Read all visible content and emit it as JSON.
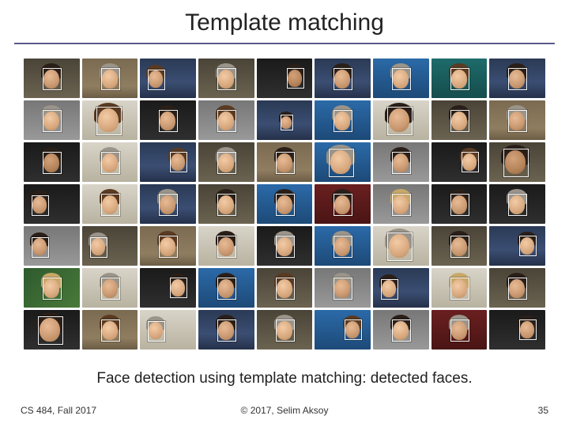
{
  "title": "Template matching",
  "caption": "Face detection using template matching: detected faces.",
  "footer": {
    "left": "CS 484, Fall 2017",
    "center": "© 2017, Selim Aksoy",
    "right": "35"
  },
  "grid": {
    "rows": 7,
    "cols": 9,
    "thumbs": [
      {
        "bg": "bg-room",
        "box": "box-c",
        "pos": "p-c",
        "skin": "skin-2",
        "hair": "hair-dark"
      },
      {
        "bg": "bg-wall",
        "box": "box-c",
        "pos": "p-c",
        "skin": "skin-1",
        "hair": "hair-gray"
      },
      {
        "bg": "bg-studio",
        "box": "box-l",
        "pos": "p-l",
        "skin": "skin-2",
        "hair": "hair-brown"
      },
      {
        "bg": "bg-room",
        "box": "box-c",
        "pos": "p-c",
        "skin": "skin-1",
        "hair": "hair-gray"
      },
      {
        "bg": "bg-dark",
        "box": "box-r",
        "pos": "p-r",
        "skin": "skin-3",
        "hair": "hair-dark"
      },
      {
        "bg": "bg-studio",
        "box": "box-c",
        "pos": "p-c",
        "skin": "skin-2",
        "hair": "hair-dark"
      },
      {
        "bg": "bg-blue",
        "box": "box-c",
        "pos": "p-c",
        "skin": "skin-1",
        "hair": "hair-gray"
      },
      {
        "bg": "bg-teal",
        "box": "box-c",
        "pos": "p-c",
        "skin": "skin-1",
        "hair": "hair-brown"
      },
      {
        "bg": "bg-studio",
        "box": "box-c",
        "pos": "p-c",
        "skin": "skin-2",
        "hair": "hair-dark"
      },
      {
        "bg": "bg-gray",
        "box": "box-c",
        "pos": "p-c",
        "skin": "skin-1",
        "hair": "hair-gray"
      },
      {
        "bg": "bg-bright",
        "box": "box-lg",
        "pos": "p-lg",
        "skin": "skin-1",
        "hair": "hair-brown"
      },
      {
        "bg": "bg-dark",
        "box": "box-c",
        "pos": "p-c",
        "skin": "skin-2",
        "hair": "hair-dark"
      },
      {
        "bg": "bg-gray",
        "box": "box-c",
        "pos": "p-c",
        "skin": "skin-1",
        "hair": "hair-brown"
      },
      {
        "bg": "bg-studio",
        "box": "box-sm",
        "pos": "p-sm",
        "skin": "skin-2",
        "hair": "hair-dark"
      },
      {
        "bg": "bg-blue",
        "box": "box-c",
        "pos": "p-c",
        "skin": "skin-1",
        "hair": "hair-gray"
      },
      {
        "bg": "bg-bright",
        "box": "box-lg",
        "pos": "p-lg",
        "skin": "skin-2",
        "hair": "hair-dark"
      },
      {
        "bg": "bg-room",
        "box": "box-c",
        "pos": "p-c",
        "skin": "skin-1",
        "hair": "hair-dark"
      },
      {
        "bg": "bg-wall",
        "box": "box-c",
        "pos": "p-c",
        "skin": "skin-2",
        "hair": "hair-gray"
      },
      {
        "bg": "bg-dark",
        "box": "box-c",
        "pos": "p-c",
        "skin": "skin-3",
        "hair": "hair-dark"
      },
      {
        "bg": "bg-bright",
        "box": "box-c",
        "pos": "p-c",
        "skin": "skin-1",
        "hair": "hair-gray"
      },
      {
        "bg": "bg-studio",
        "box": "box-r",
        "pos": "p-r",
        "skin": "skin-2",
        "hair": "hair-brown"
      },
      {
        "bg": "bg-room",
        "box": "box-c",
        "pos": "p-c",
        "skin": "skin-1",
        "hair": "hair-gray"
      },
      {
        "bg": "bg-wall",
        "box": "box-c",
        "pos": "p-c",
        "skin": "skin-2",
        "hair": "hair-dark"
      },
      {
        "bg": "bg-blue",
        "box": "box-lg",
        "pos": "p-lg",
        "skin": "skin-1",
        "hair": "hair-gray"
      },
      {
        "bg": "bg-gray",
        "box": "box-c",
        "pos": "p-c",
        "skin": "skin-2",
        "hair": "hair-dark"
      },
      {
        "bg": "bg-dark",
        "box": "box-r",
        "pos": "p-r",
        "skin": "skin-1",
        "hair": "hair-brown"
      },
      {
        "bg": "bg-room",
        "box": "box-lg",
        "pos": "p-lg",
        "skin": "skin-3",
        "hair": "hair-dark"
      },
      {
        "bg": "bg-dark",
        "box": "box-l",
        "pos": "p-l",
        "skin": "skin-2",
        "hair": "hair-dark"
      },
      {
        "bg": "bg-bright",
        "box": "box-c",
        "pos": "p-c",
        "skin": "skin-1",
        "hair": "hair-brown"
      },
      {
        "bg": "bg-studio",
        "box": "box-c",
        "pos": "p-c",
        "skin": "skin-2",
        "hair": "hair-gray"
      },
      {
        "bg": "bg-room",
        "box": "box-c",
        "pos": "p-c",
        "skin": "skin-1",
        "hair": "hair-dark"
      },
      {
        "bg": "bg-blue",
        "box": "box-c",
        "pos": "p-c",
        "skin": "skin-2",
        "hair": "hair-dark"
      },
      {
        "bg": "bg-red",
        "box": "box-c",
        "pos": "p-c",
        "skin": "skin-2",
        "hair": "hair-dark"
      },
      {
        "bg": "bg-gray",
        "box": "box-c",
        "pos": "p-c",
        "skin": "skin-1",
        "hair": "hair-blond"
      },
      {
        "bg": "bg-dark",
        "box": "box-c",
        "pos": "p-c",
        "skin": "skin-2",
        "hair": "hair-dark"
      },
      {
        "bg": "bg-dark",
        "box": "box-c",
        "pos": "p-c",
        "skin": "skin-1",
        "hair": "hair-gray"
      },
      {
        "bg": "bg-gray",
        "box": "box-l",
        "pos": "p-l",
        "skin": "skin-2",
        "hair": "hair-dark"
      },
      {
        "bg": "bg-room",
        "box": "box-l",
        "pos": "p-l",
        "skin": "skin-1",
        "hair": "hair-gray"
      },
      {
        "bg": "bg-wall",
        "box": "box-c",
        "pos": "p-c",
        "skin": "skin-1",
        "hair": "hair-brown"
      },
      {
        "bg": "bg-bright",
        "box": "box-c",
        "pos": "p-c",
        "skin": "skin-2",
        "hair": "hair-dark"
      },
      {
        "bg": "bg-dark",
        "box": "box-c",
        "pos": "p-c",
        "skin": "skin-1",
        "hair": "hair-gray"
      },
      {
        "bg": "bg-blue",
        "box": "box-c",
        "pos": "p-c",
        "skin": "skin-2",
        "hair": "hair-gray"
      },
      {
        "bg": "bg-bright",
        "box": "box-lg",
        "pos": "p-lg",
        "skin": "skin-1",
        "hair": "hair-gray"
      },
      {
        "bg": "bg-room",
        "box": "box-c",
        "pos": "p-c",
        "skin": "skin-2",
        "hair": "hair-dark"
      },
      {
        "bg": "bg-studio",
        "box": "box-r",
        "pos": "p-r",
        "skin": "skin-1",
        "hair": "hair-dark"
      },
      {
        "bg": "bg-green",
        "box": "box-c",
        "pos": "p-c",
        "skin": "skin-1",
        "hair": "hair-blond"
      },
      {
        "bg": "bg-bright",
        "box": "box-c",
        "pos": "p-c",
        "skin": "skin-2",
        "hair": "hair-gray"
      },
      {
        "bg": "bg-dark",
        "box": "box-r",
        "pos": "p-r",
        "skin": "skin-1",
        "hair": "hair-dark"
      },
      {
        "bg": "bg-blue",
        "box": "box-c",
        "pos": "p-c",
        "skin": "skin-2",
        "hair": "hair-dark"
      },
      {
        "bg": "bg-room",
        "box": "box-c",
        "pos": "p-c",
        "skin": "skin-1",
        "hair": "hair-brown"
      },
      {
        "bg": "bg-gray",
        "box": "box-c",
        "pos": "p-c",
        "skin": "skin-2",
        "hair": "hair-gray"
      },
      {
        "bg": "bg-studio",
        "box": "box-l",
        "pos": "p-l",
        "skin": "skin-1",
        "hair": "hair-dark"
      },
      {
        "bg": "bg-bright",
        "box": "box-c",
        "pos": "p-c",
        "skin": "skin-1",
        "hair": "hair-blond"
      },
      {
        "bg": "bg-room",
        "box": "box-c",
        "pos": "p-c",
        "skin": "skin-2",
        "hair": "hair-dark"
      },
      {
        "bg": "bg-dark",
        "box": "box-lg",
        "pos": "p-lg",
        "skin": "skin-2",
        "hair": "hair-dark"
      },
      {
        "bg": "bg-wall",
        "box": "box-c",
        "pos": "p-c",
        "skin": "skin-1",
        "hair": "hair-brown"
      },
      {
        "bg": "bg-bright",
        "box": "box-l",
        "pos": "p-l",
        "skin": "skin-1",
        "hair": "hair-gray"
      },
      {
        "bg": "bg-studio",
        "box": "box-c",
        "pos": "p-c",
        "skin": "skin-2",
        "hair": "hair-dark"
      },
      {
        "bg": "bg-room",
        "box": "box-c",
        "pos": "p-c",
        "skin": "skin-1",
        "hair": "hair-gray"
      },
      {
        "bg": "bg-blue",
        "box": "box-r",
        "pos": "p-r",
        "skin": "skin-2",
        "hair": "hair-brown"
      },
      {
        "bg": "bg-gray",
        "box": "box-c",
        "pos": "p-c",
        "skin": "skin-1",
        "hair": "hair-dark"
      },
      {
        "bg": "bg-red",
        "box": "box-c",
        "pos": "p-c",
        "skin": "skin-2",
        "hair": "hair-gray"
      },
      {
        "bg": "bg-dark",
        "box": "box-r",
        "pos": "p-r",
        "skin": "skin-2",
        "hair": "hair-dark"
      }
    ]
  }
}
